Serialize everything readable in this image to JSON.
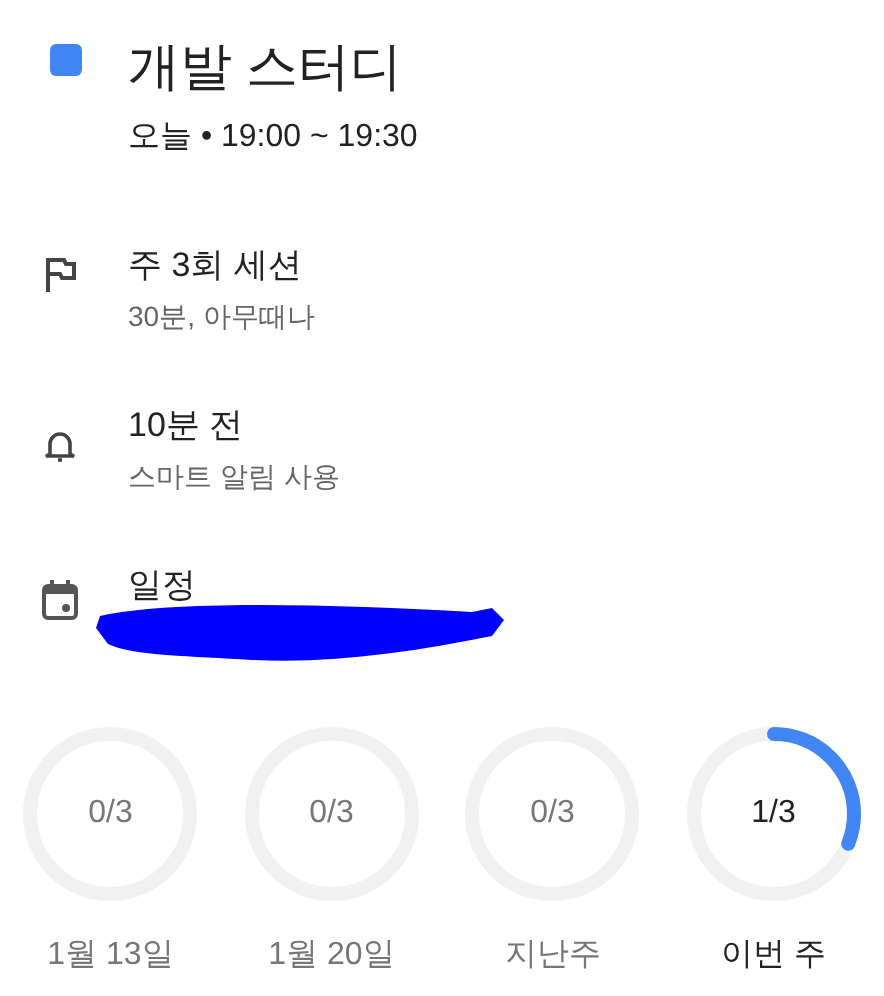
{
  "event": {
    "color": "#4285f4",
    "title": "개발 스터디",
    "when": "오늘 • 19:00 ~ 19:30"
  },
  "details": [
    {
      "kind": "flag",
      "title": "주 3회 세션",
      "subtitle": "30분, 아무때나"
    },
    {
      "kind": "bell",
      "title": "10분 전",
      "subtitle": "스마트 알림 사용"
    },
    {
      "kind": "calendar",
      "title": "일정"
    }
  ],
  "weeks": [
    {
      "count": "0/3",
      "label": "1월 13일",
      "current": false
    },
    {
      "count": "0/3",
      "label": "1월 20일",
      "current": false
    },
    {
      "count": "0/3",
      "label": "지난주",
      "current": false
    },
    {
      "count": "1/3",
      "label": "이번 주",
      "current": true
    }
  ]
}
